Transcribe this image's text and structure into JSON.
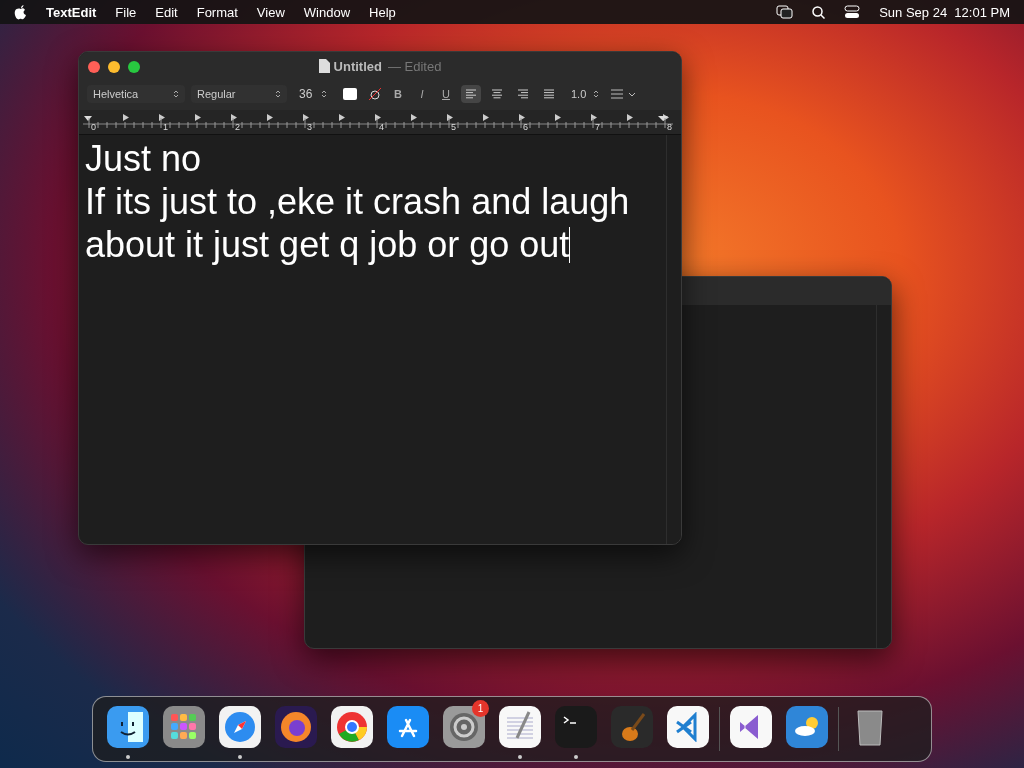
{
  "menubar": {
    "app": "TextEdit",
    "menus": [
      "File",
      "Edit",
      "Format",
      "View",
      "Window",
      "Help"
    ],
    "clock": "Sun Sep 24  12:01 PM"
  },
  "window": {
    "title": "Untitled",
    "status": "— Edited",
    "toolbar": {
      "font": "Helvetica",
      "style": "Regular",
      "size": "36",
      "styles": [
        "B",
        "I",
        "U"
      ],
      "alignments": [
        {
          "kind": "left",
          "selected": true
        },
        {
          "kind": "center",
          "selected": false
        },
        {
          "kind": "right",
          "selected": false
        },
        {
          "kind": "justify",
          "selected": false
        }
      ],
      "spacing": "1.0"
    },
    "ruler": [
      "0",
      "1",
      "2",
      "3",
      "4",
      "5",
      "6",
      "7",
      "8"
    ],
    "lines": [
      "Just no",
      "If its just to ,eke it crash and laugh",
      "about it just get q job or go out"
    ]
  },
  "dock": [
    {
      "kind": "finder",
      "running": true
    },
    {
      "kind": "launchpad",
      "running": false
    },
    {
      "kind": "safari",
      "running": true
    },
    {
      "kind": "firefox",
      "running": false
    },
    {
      "kind": "chrome",
      "running": false
    },
    {
      "kind": "appstore",
      "running": false
    },
    {
      "kind": "settings",
      "running": false,
      "badge": "1"
    },
    {
      "kind": "textedit",
      "running": true
    },
    {
      "kind": "terminal",
      "running": true
    },
    {
      "kind": "garageband",
      "running": false
    },
    {
      "kind": "vscode",
      "running": false
    },
    {
      "kind": "separator"
    },
    {
      "kind": "visualstudio",
      "running": false
    },
    {
      "kind": "weather",
      "running": false
    },
    {
      "kind": "separator"
    },
    {
      "kind": "trash",
      "running": false
    }
  ]
}
